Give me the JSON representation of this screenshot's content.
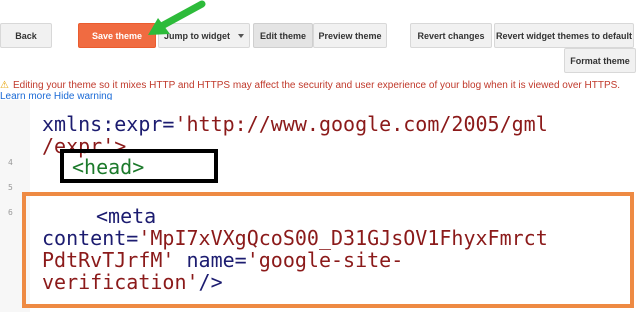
{
  "toolbar": {
    "back_label": "Back",
    "save_label": "Save theme",
    "jump_label": "Jump to widget",
    "edit_label": "Edit theme",
    "preview_label": "Preview theme",
    "revert_label": "Revert changes",
    "revert_widget_label": "Revert widget themes to default",
    "format_label": "Format theme"
  },
  "warning": {
    "text": "Editing your theme so it mixes HTTP and HTTPS may affect the security and user experience of your blog when it is viewed over HTTPS.",
    "learn_more": "Learn more",
    "hide": "Hide warning"
  },
  "editor": {
    "line_numbers": [
      "4",
      "5",
      "6"
    ],
    "line1_attr": "xmlns:expr",
    "line1_eq": "=",
    "line1_val": "'http://www.google.com/2005/gml",
    "line2_val": "/expr'>",
    "head_tag": "<head>",
    "meta_open": "<meta",
    "content_attr": "content",
    "content_val_1": "'MpI7xVXgQcoS00_D31GJsOV1FhyxFmrct",
    "content_val_2": "PdtRvTJrfM'",
    "name_attr": "name",
    "name_val_1": "'google-site-",
    "name_val_2": "verification'",
    "close": "/>"
  },
  "colors": {
    "save_button": "#f06b41",
    "highlight_orange": "#ee8a43",
    "highlight_black": "#000000",
    "arrow_green": "#2dbb3a"
  }
}
